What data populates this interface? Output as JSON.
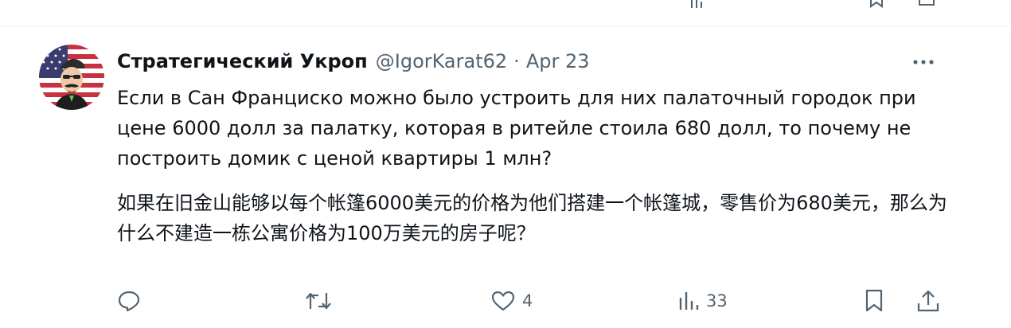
{
  "tweet": {
    "author": {
      "display_name": "Стратегический Укроп",
      "handle": "@IgorKarat62"
    },
    "separator": "·",
    "timestamp": "Apr 23",
    "text_russian": "Если в Сан Франциско можно было устроить для них палаточный городок при цене 6000 долл за палатку, которая в ритейле стоила 680 долл, то почему не построить домик с ценой квартиры 1 млн?",
    "text_translation": "如果在旧金山能够以每个帐篷6000美元的价格为他们搭建一个帐篷城，零售价为680美元，那么为什么不建造一栋公寓价格为100万美元的房子呢？",
    "actions": {
      "reply": {
        "icon": "reply-icon"
      },
      "retweet": {
        "icon": "retweet-icon"
      },
      "like": {
        "icon": "heart-icon",
        "count": "4"
      },
      "views": {
        "icon": "views-icon",
        "count": "33"
      },
      "bookmark": {
        "icon": "bookmark-icon"
      },
      "share": {
        "icon": "share-icon"
      }
    },
    "colors": {
      "text_primary": "#0f1419",
      "text_secondary": "#536471",
      "divider": "#eff3f4",
      "flag_red": "#c8313e",
      "flag_blue": "#3c3b6e"
    }
  }
}
